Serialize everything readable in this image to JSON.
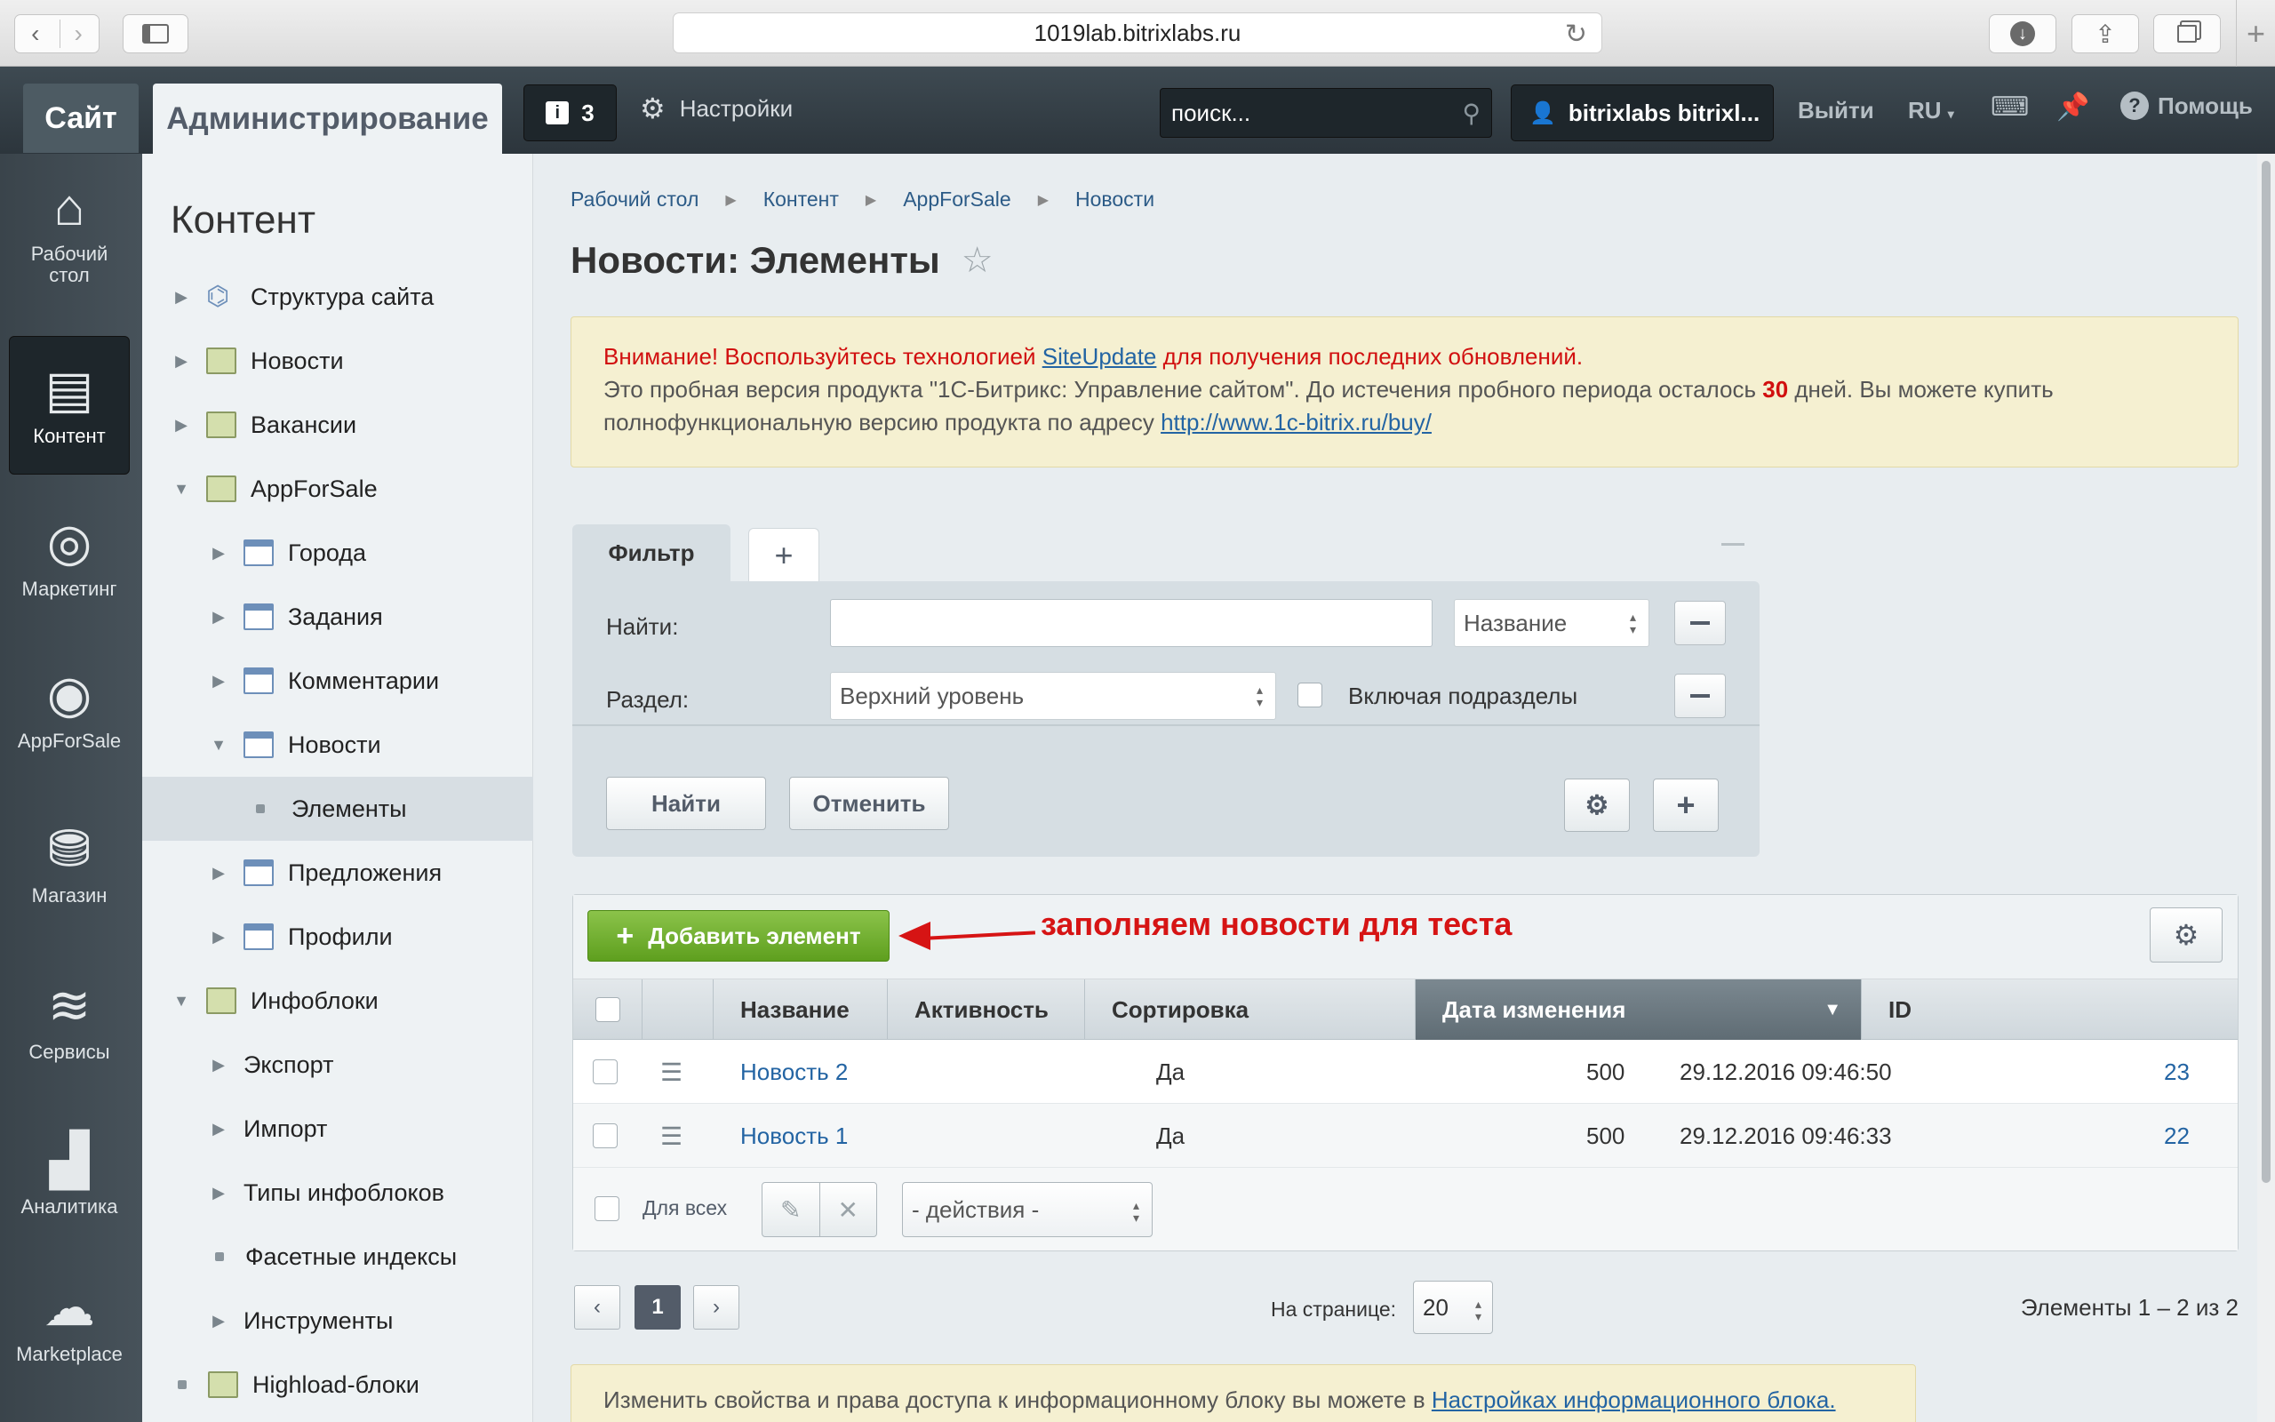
{
  "browser": {
    "url": "1019lab.bitrixlabs.ru"
  },
  "topbar": {
    "site_tab": "Сайт",
    "admin_tab": "Администрирование",
    "notifications_count": "3",
    "settings_label": "Настройки",
    "search_placeholder": "поиск...",
    "user_name": "bitrixlabs bitrixl...",
    "logout": "Выйти",
    "lang": "RU",
    "help": "Помощь"
  },
  "iconbar": {
    "items": [
      {
        "label": "Рабочий стол",
        "icon": "home-icon"
      },
      {
        "label": "Контент",
        "icon": "document-icon"
      },
      {
        "label": "Маркетинг",
        "icon": "target-icon"
      },
      {
        "label": "AppForSale",
        "icon": "appforsale-icon"
      },
      {
        "label": "Магазин",
        "icon": "basket-icon"
      },
      {
        "label": "Сервисы",
        "icon": "layers-icon"
      },
      {
        "label": "Аналитика",
        "icon": "bar-chart-icon"
      },
      {
        "label": "Marketplace",
        "icon": "cloud-download-icon"
      }
    ]
  },
  "menu": {
    "title": "Контент",
    "items": [
      {
        "label": "Структура сайта"
      },
      {
        "label": "Новости"
      },
      {
        "label": "Вакансии"
      },
      {
        "label": "AppForSale"
      },
      {
        "label": "Города"
      },
      {
        "label": "Задания"
      },
      {
        "label": "Комментарии"
      },
      {
        "label": "Новости"
      },
      {
        "label": "Элементы"
      },
      {
        "label": "Предложения"
      },
      {
        "label": "Профили"
      },
      {
        "label": "Инфоблоки"
      },
      {
        "label": "Экспорт"
      },
      {
        "label": "Импорт"
      },
      {
        "label": "Типы инфоблоков"
      },
      {
        "label": "Фасетные индексы"
      },
      {
        "label": "Инструменты"
      },
      {
        "label": "Highload-блоки"
      }
    ]
  },
  "breadcrumbs": [
    "Рабочий стол",
    "Контент",
    "AppForSale",
    "Новости"
  ],
  "page_title": "Новости: Элементы",
  "alert": {
    "line1_prefix": "Внимание! Воспользуйтесь технологией ",
    "line1_link": "SiteUpdate",
    "line1_suffix": " для получения последних обновлений.",
    "line2_prefix": "Это пробная версия продукта \"1С-Битрикс: Управление сайтом\". До истечения пробного периода осталось ",
    "days": "30",
    "line2_suffix": " дней. Вы можете купить",
    "line3_prefix": "полнофункциональную версию продукта по адресу ",
    "line3_link": "http://www.1c-bitrix.ru/buy/"
  },
  "filter": {
    "tab_label": "Фильтр",
    "find_label": "Найти:",
    "find_value": "",
    "find_field": "Название",
    "section_label": "Раздел:",
    "section_value": "Верхний уровень",
    "include_sub": "Включая подразделы",
    "find_button": "Найти",
    "cancel_button": "Отменить"
  },
  "grid": {
    "add_button": "Добавить элемент",
    "annotation": "заполняем новости для теста",
    "columns": [
      "Название",
      "Активность",
      "Сортировка",
      "Дата изменения",
      "ID"
    ],
    "rows": [
      {
        "name": "Новость 2",
        "active": "Да",
        "sort": "500",
        "date": "29.12.2016 09:46:50",
        "id": "23"
      },
      {
        "name": "Новость 1",
        "active": "Да",
        "sort": "500",
        "date": "29.12.2016 09:46:33",
        "id": "22"
      }
    ],
    "for_all": "Для всех",
    "actions": "- действия -"
  },
  "pagination": {
    "current_page": "1",
    "per_page_label": "На странице:",
    "per_page_value": "20",
    "count": "Элементы 1 – 2 из 2"
  },
  "bottom_note": {
    "text": "Изменить свойства и права доступа к информационному блоку вы можете в ",
    "link": "Настройках информационного блока."
  }
}
